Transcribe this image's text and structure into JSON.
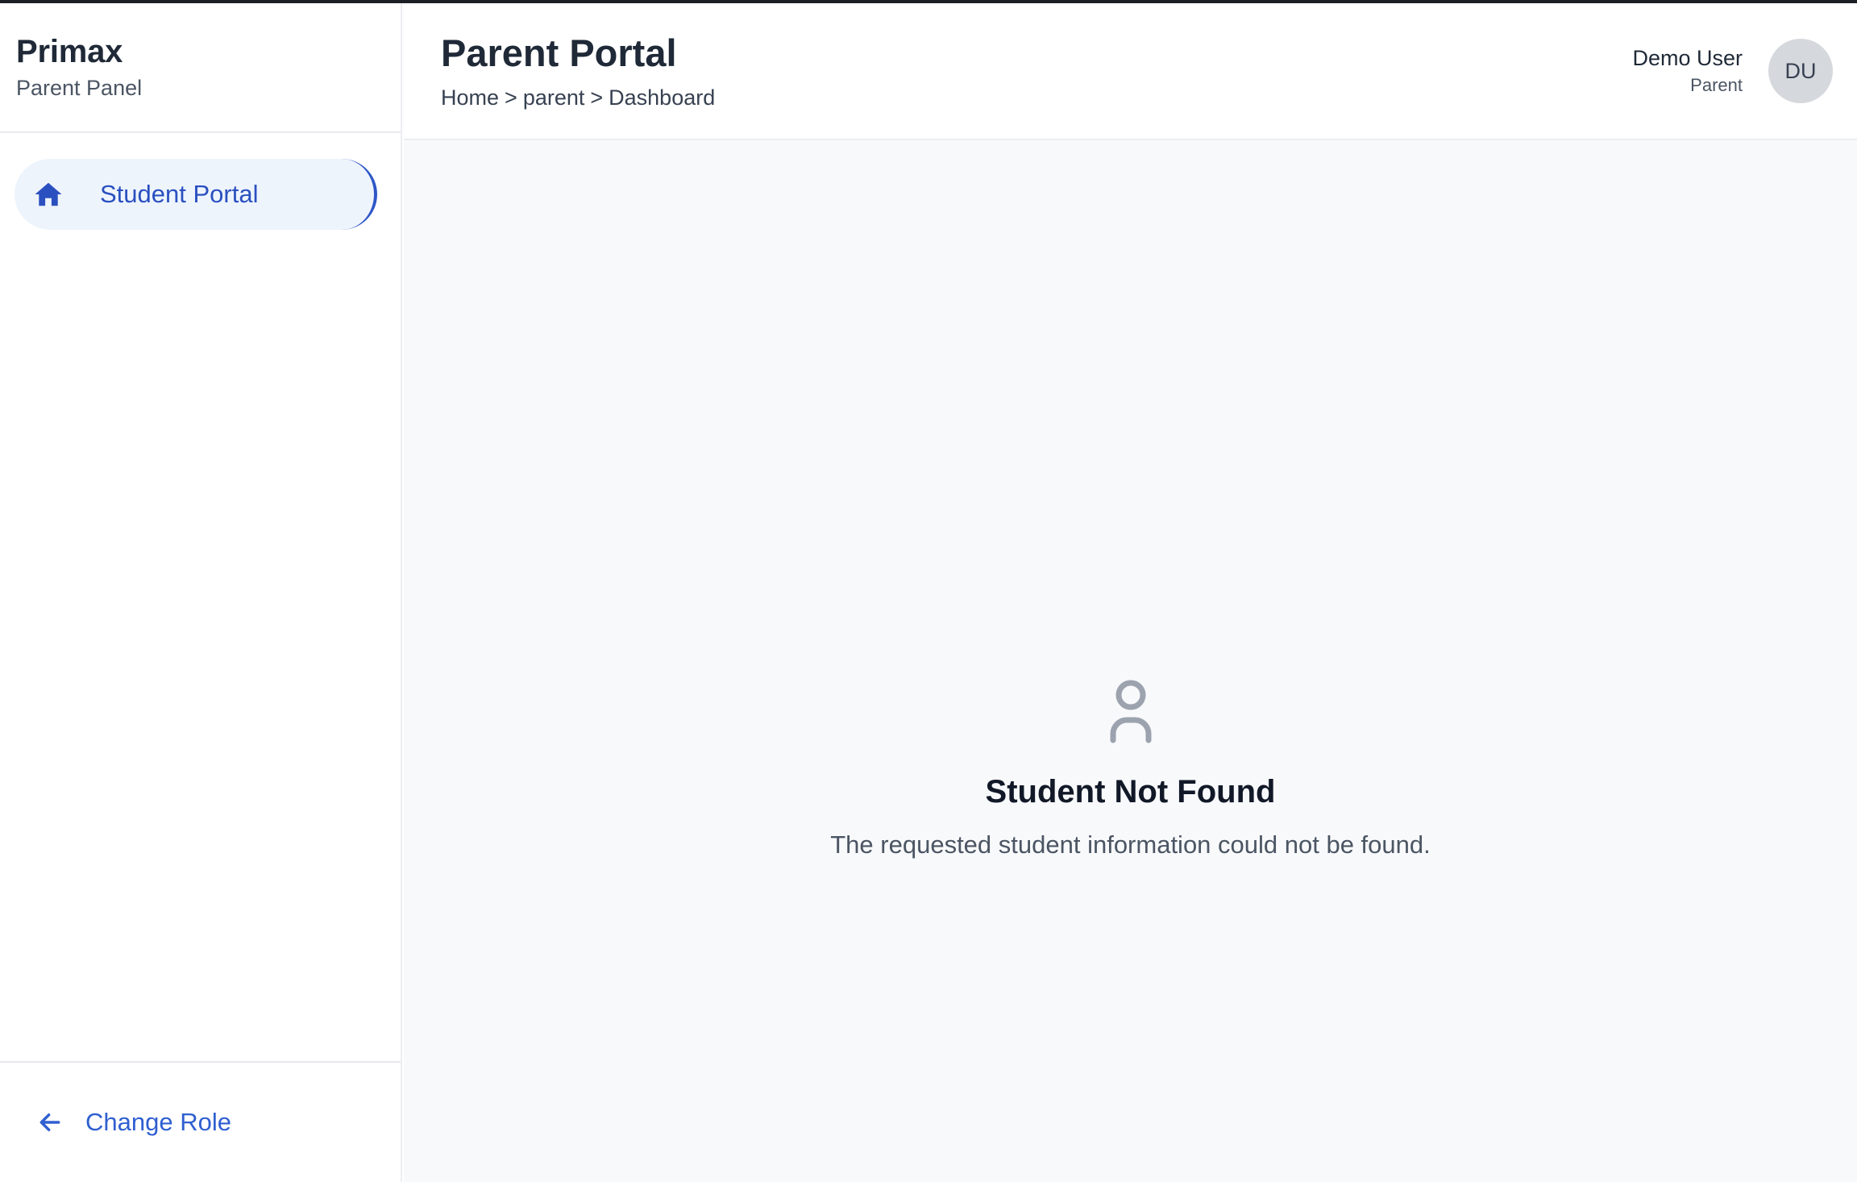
{
  "sidebar": {
    "brand_title": "Primax",
    "brand_subtitle": "Parent Panel",
    "nav": [
      {
        "label": "Student Portal",
        "icon": "home-icon",
        "active": true
      }
    ],
    "footer": {
      "label": "Change Role",
      "icon": "arrow-left-icon"
    }
  },
  "header": {
    "title": "Parent Portal",
    "breadcrumb": [
      "Home",
      "parent",
      "Dashboard"
    ],
    "breadcrumb_separator": ">",
    "user": {
      "name": "Demo User",
      "role": "Parent",
      "initials": "DU"
    }
  },
  "main": {
    "empty_state": {
      "icon": "user-icon",
      "title": "Student Not Found",
      "message": "The requested student information could not be found."
    }
  },
  "colors": {
    "accent": "#2a50c0",
    "active_bg": "#eef4fc",
    "main_bg": "#f8f9fb",
    "avatar_bg": "#d5d8dd",
    "icon_gray": "#9ca3af"
  }
}
